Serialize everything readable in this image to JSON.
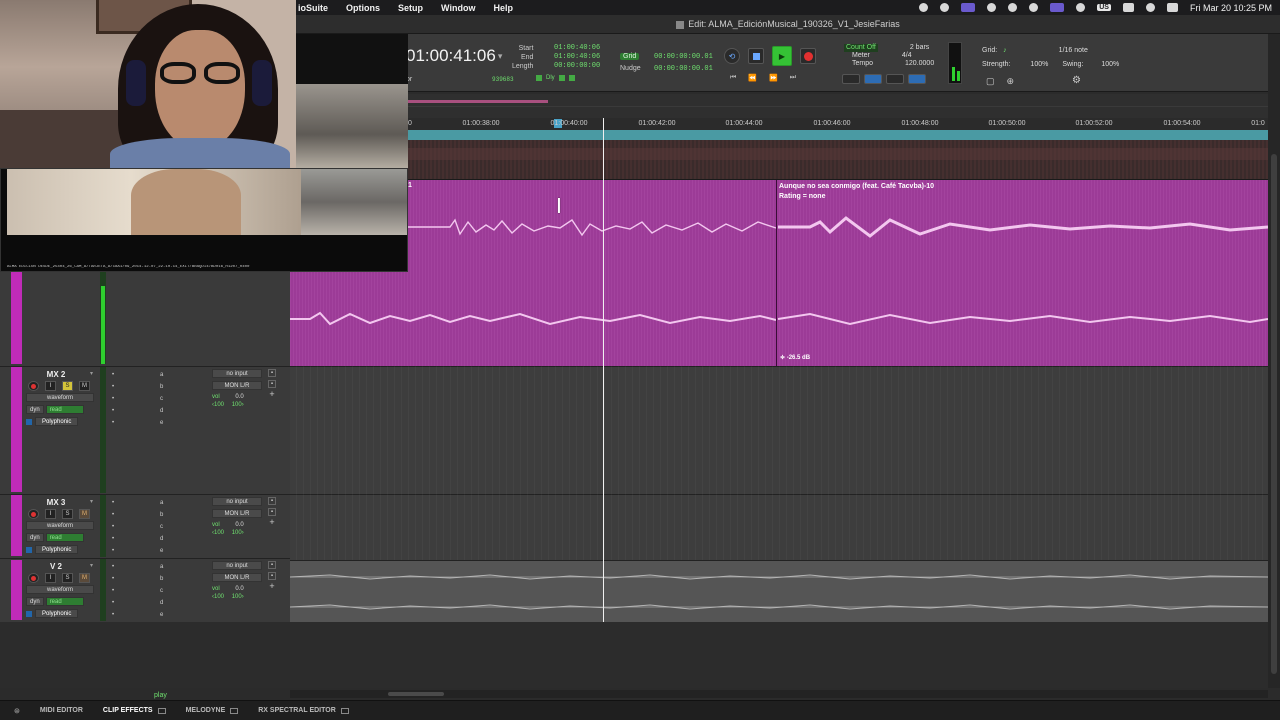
{
  "menubar": {
    "items": [
      "ioSuite",
      "Options",
      "Setup",
      "Window",
      "Help"
    ],
    "status": {
      "keyboard": "US",
      "clock": "Fri Mar 20  10:25 PM"
    }
  },
  "window": {
    "title": "Edit: ALMA_EdiciónMusical_190326_V1_JesieFarias"
  },
  "toolbar": {
    "main_counter": "01:00:41:06",
    "sel_labels": [
      "Start",
      "End",
      "Length"
    ],
    "sel_values": [
      "01:00:40:06",
      "01:00:40:06",
      "00:00:00:00"
    ],
    "sub_left": "or",
    "sub_number": "939683",
    "sub_dly": "Dly",
    "grid_label": "Grid",
    "grid_value": "00:00:00:00.01",
    "nudge_label": "Nudge",
    "nudge_value": "00:00:00:00.01",
    "count_off": "Count Off",
    "count_off_value": "2 bars",
    "meter_label": "Meter",
    "meter_value": "4/4",
    "tempo_label": "Tempo",
    "tempo_value": "120.0000",
    "grid_section": {
      "grid": "Grid:",
      "note": "1/16 note",
      "strength_label": "Strength:",
      "strength_value": "100%",
      "swing_label": "Swing:",
      "swing_value": "100%"
    }
  },
  "ruler": {
    "timecodes": [
      {
        "label": "01:00:38:00"
      },
      {
        "label": "01:00:40:00"
      },
      {
        "label": "01:00:42:00"
      },
      {
        "label": "01:00:44:00"
      },
      {
        "label": "01:00:46:00"
      },
      {
        "label": "01:00:48:00"
      },
      {
        "label": "01:00:50:00"
      },
      {
        "label": "01:00:52:00"
      },
      {
        "label": "01:00:54:00"
      }
    ],
    "edge_left": "0",
    "edge_right": "01:0"
  },
  "clips": {
    "clip_a_name": "1",
    "clip_b_name": "Aunque no sea conmigo (feat. Café Tacvba)-10",
    "clip_b_rating": "Rating = none",
    "clip_b_gain": "-26.5 dB"
  },
  "video": {
    "caption": "ALMA EDICIÓN DESDE_25404_26_CAM_A/TARJETA_A/18A1/09_2014-12-07_22-10-14_EXIT/BRAQDI4/BD016_H1207_R400"
  },
  "tracks": [
    {
      "name": "MX 2",
      "view": "waveform",
      "auto_dyn": "dyn",
      "auto_mode": "read",
      "elastic": "Polyphonic",
      "sends": [
        "a",
        "b",
        "c",
        "d",
        "e"
      ],
      "input": "no input",
      "output": "MON L/R",
      "vol_label": "vol",
      "vol_value": "0.0",
      "pan_l": "‹100",
      "pan_r": "100›"
    },
    {
      "name": "MX 3",
      "view": "waveform",
      "auto_dyn": "dyn",
      "auto_mode": "read",
      "elastic": "Polyphonic",
      "sends": [
        "a",
        "b",
        "c",
        "d",
        "e"
      ],
      "input": "no input",
      "output": "MON L/R",
      "vol_label": "vol",
      "vol_value": "0.0",
      "pan_l": "‹100",
      "pan_r": "100›"
    },
    {
      "name": "V 2",
      "view": "waveform",
      "auto_dyn": "dyn",
      "auto_mode": "read",
      "elastic": "Polyphonic",
      "sends": [
        "a",
        "b",
        "c",
        "d",
        "e"
      ],
      "input": "no input",
      "output": "MON L/R",
      "vol_label": "vol",
      "vol_value": "0.0",
      "pan_l": "‹100",
      "pan_r": "100›"
    }
  ],
  "status_play": "play",
  "bottom_tabs": [
    "MIDI EDITOR",
    "CLIP EFFECTS",
    "MELODYNE",
    "RX SPECTRAL EDITOR"
  ],
  "colors": {
    "clip": "#9c3b97",
    "selected_strip": "#c02bb8",
    "counter_green": "#6fe06f",
    "play_button": "#35c235"
  }
}
